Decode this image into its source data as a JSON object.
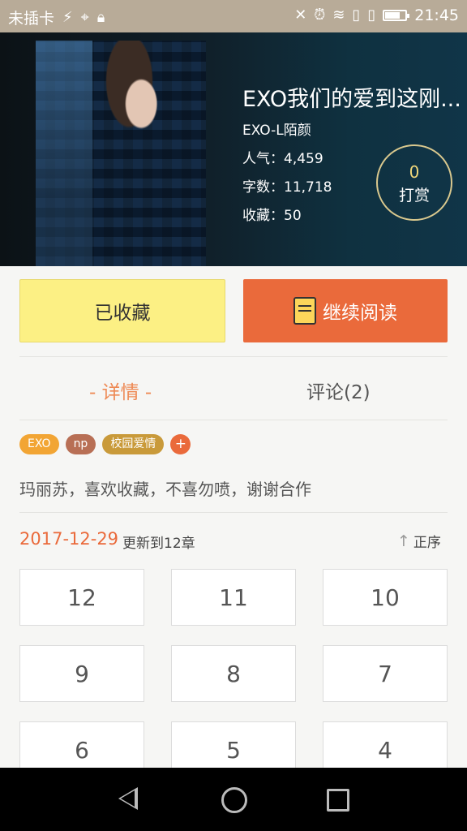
{
  "status_bar": {
    "carrier": "未插卡",
    "time": "21:45",
    "battery_level": 0.75
  },
  "book": {
    "title": "EXO我们的爱到这刚...",
    "author": "EXO-L陌颜",
    "popularity_label": "人气：",
    "popularity": "4,459",
    "words_label": "字数：",
    "words": "11,718",
    "favorites_label": "收藏：",
    "favorites": "50",
    "tip_count": "0",
    "tip_label": "打赏"
  },
  "actions": {
    "favorited_label": "已收藏",
    "continue_label": "继续阅读"
  },
  "tabs": {
    "detail_label": "- 详情 -",
    "comments_label": "评论(2)"
  },
  "tags": [
    {
      "label": "EXO",
      "color": "#f2a534"
    },
    {
      "label": "np",
      "color": "#b86f55"
    },
    {
      "label": "校园爱情",
      "color": "#c99a3a"
    }
  ],
  "tag_add_label": "+",
  "description": "玛丽苏，喜欢收藏，不喜勿喷，谢谢合作",
  "update": {
    "date": "2017-12-29",
    "text": "更新到12章",
    "sort_label": "正序"
  },
  "chapters": [
    "12",
    "11",
    "10",
    "9",
    "8",
    "7",
    "6",
    "5",
    "4"
  ],
  "colors": {
    "accent": "#ea6a3b",
    "favorite_button": "#fcf084",
    "status_bar": "#b8ab98"
  }
}
